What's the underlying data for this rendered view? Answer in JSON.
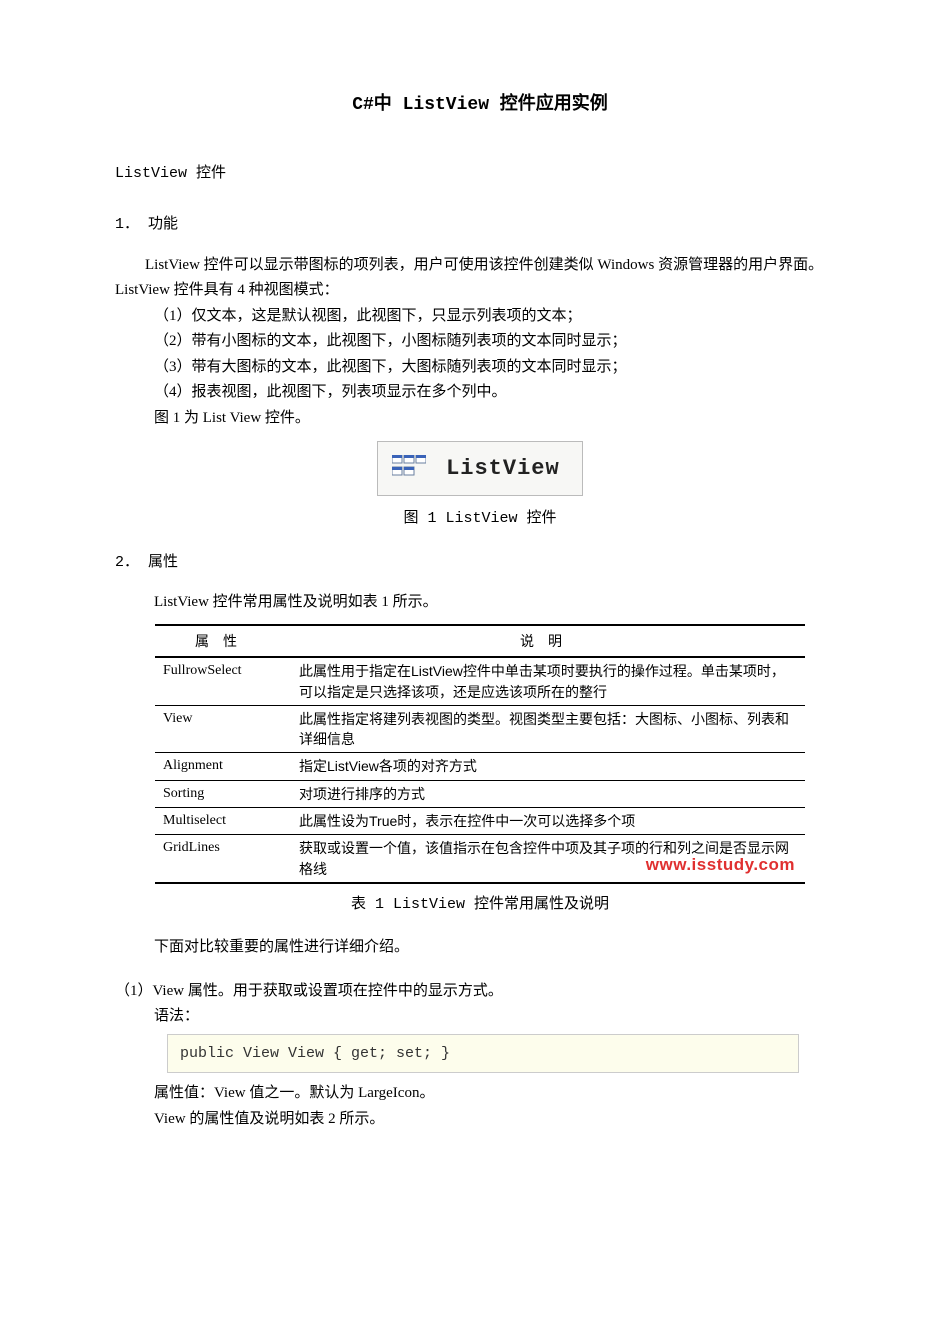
{
  "title": "C#中 ListView 控件应用实例",
  "subtitle": "ListView 控件",
  "sec1": {
    "num": "1．",
    "head": "功能",
    "p1": "ListView 控件可以显示带图标的项列表，用户可使用该控件创建类似 Windows 资源管理器的用户界面。ListView 控件具有 4 种视图模式：",
    "i1": "（1）仅文本，这是默认视图，此视图下，只显示列表项的文本；",
    "i2": "（2）带有小图标的文本，此视图下，小图标随列表项的文本同时显示；",
    "i3": "（3）带有大图标的文本，此视图下，大图标随列表项的文本同时显示；",
    "i4": "（4）报表视图，此视图下，列表项显示在多个列中。",
    "figline": "图 1 为 List View 控件。"
  },
  "figure1": {
    "label": "ListView",
    "caption": "图 1  ListView 控件"
  },
  "sec2": {
    "num": "2．",
    "head": "属性",
    "lead": "ListView 控件常用属性及说明如表 1 所示。"
  },
  "table1": {
    "h1": "属性",
    "h2": "说明",
    "rows": [
      {
        "p": "FullrowSelect",
        "d": "此属性用于指定在ListView控件中单击某项时要执行的操作过程。单击某项时，可以指定是只选择该项，还是应选该项所在的整行"
      },
      {
        "p": "View",
        "d": "此属性指定将建列表视图的类型。视图类型主要包括：大图标、小图标、列表和详细信息"
      },
      {
        "p": "Alignment",
        "d": "指定ListView各项的对齐方式"
      },
      {
        "p": "Sorting",
        "d": "对项进行排序的方式"
      },
      {
        "p": "Multiselect",
        "d": "此属性设为True时，表示在控件中一次可以选择多个项"
      },
      {
        "p": "GridLines",
        "d": "获取或设置一个值，该值指示在包含控件中项及其子项的行和列之间是否显示网格线"
      }
    ]
  },
  "watermark": "www.isstudy.com",
  "table1cap": "表 1    ListView 控件常用属性及说明",
  "afterTable": "下面对比较重要的属性进行详细介绍。",
  "sec3": {
    "head": "（1）View 属性。用于获取或设置项在控件中的显示方式。",
    "syntax_label": "语法：",
    "code": "public View View { get; set; }",
    "p1": "属性值：View 值之一。默认为 LargeIcon。",
    "p2": "View 的属性值及说明如表 2 所示。"
  }
}
